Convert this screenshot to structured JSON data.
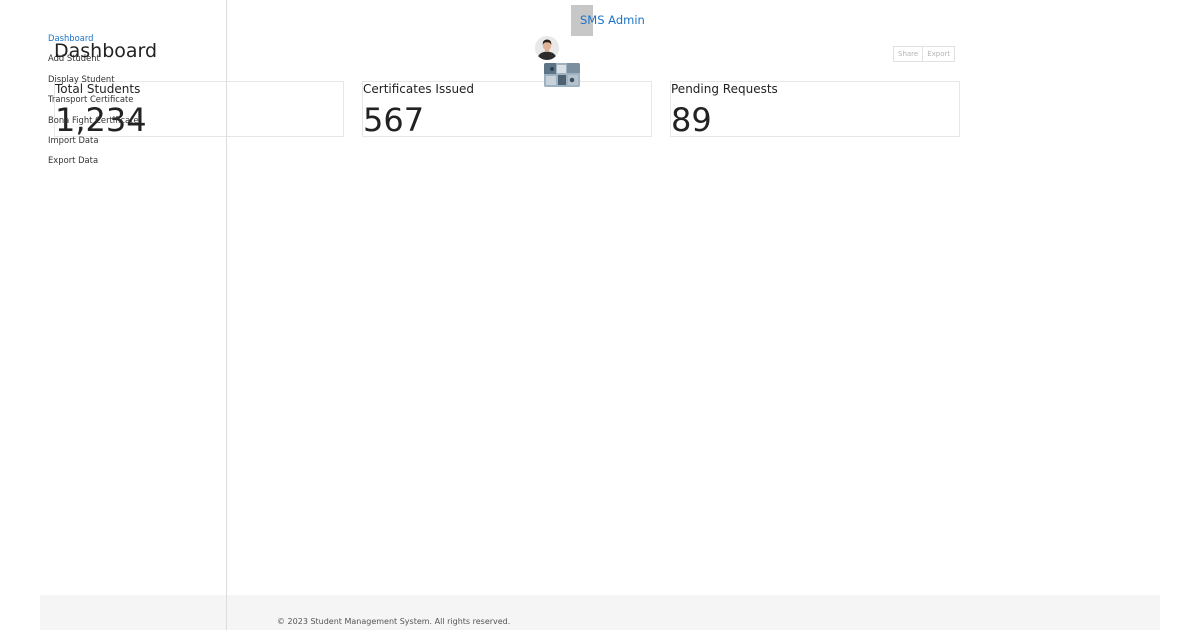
{
  "header": {
    "brand": "SMS Admin"
  },
  "sidebar": {
    "items": [
      {
        "label": "Dashboard",
        "active": true
      },
      {
        "label": "Add Student",
        "active": false
      },
      {
        "label": "Display Student",
        "active": false
      },
      {
        "label": "Transport Certificate",
        "active": false
      },
      {
        "label": "Bona Fight Certificate",
        "active": false
      },
      {
        "label": "Import Data",
        "active": false
      },
      {
        "label": "Export Data",
        "active": false
      }
    ]
  },
  "main": {
    "title": "Dashboard",
    "toolbar": {
      "share_label": "Share",
      "export_label": "Export"
    },
    "stats": [
      {
        "label": "Total Students",
        "value": "1,234"
      },
      {
        "label": "Certificates Issued",
        "value": "567"
      },
      {
        "label": "Pending Requests",
        "value": "89"
      }
    ]
  },
  "footer": {
    "text": "© 2023 Student Management System. All rights reserved."
  },
  "colors": {
    "accent": "#1a73c8",
    "brand_box": "#c7c7c7",
    "footer_bg": "#f5f5f5",
    "border": "#e6e6e6"
  },
  "icons": {
    "avatar": "user-avatar",
    "thumbnail": "photo-thumbnail"
  }
}
